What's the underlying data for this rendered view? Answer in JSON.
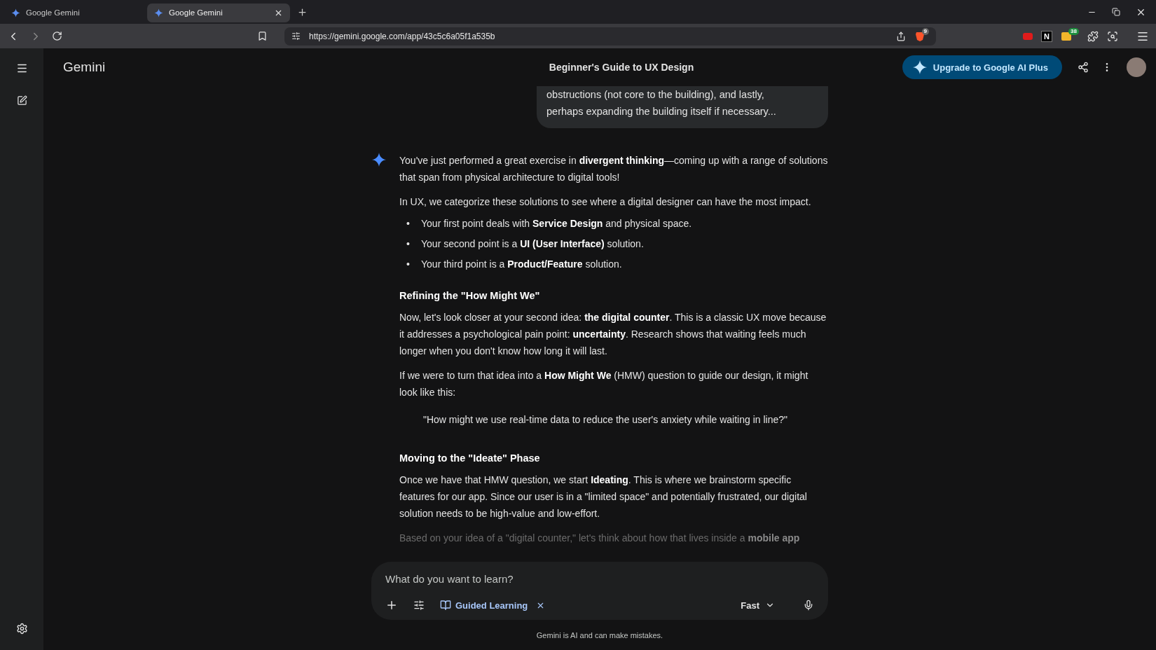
{
  "browser": {
    "tabs": [
      {
        "title": "Google Gemini",
        "selected": false
      },
      {
        "title": "Google Gemini",
        "selected": true
      }
    ],
    "url": "https://gemini.google.com/app/43c5c6a05f1a535b",
    "shield_badge": "9",
    "extensions": [
      {
        "kind": "red"
      },
      {
        "kind": "letter",
        "label": "N"
      },
      {
        "kind": "folder",
        "badge": "38"
      },
      {
        "kind": "puzzle"
      },
      {
        "kind": "reader"
      }
    ]
  },
  "app": {
    "brand": "Gemini",
    "chat_title": "Beginner's Guide to UX Design",
    "upgrade_button": "Upgrade to Google AI Plus"
  },
  "user_message": [
    "obstructions (not core to the building), and lastly,",
    "perhaps expanding the building itself if necessary..."
  ],
  "response": [
    {
      "kind": "paragraph",
      "text": "You've just performed a great exercise in **divergent thinking**—coming up with a range of solutions that span from physical architecture to digital tools!"
    },
    {
      "kind": "paragraph",
      "text": "In UX, we categorize these solutions to see where a digital designer can have the most impact."
    },
    {
      "kind": "bullets",
      "items": [
        {
          "marker": "•",
          "text": "Your first point deals with **Service Design** and physical space."
        },
        {
          "marker": "•",
          "text": "Your second point is a **UI (User Interface)** solution."
        },
        {
          "marker": "•",
          "text": "Your third point is a **Product/Feature** solution."
        }
      ]
    },
    {
      "kind": "heading",
      "text": "Refining the \"How Might We\""
    },
    {
      "kind": "paragraph",
      "text": "Now, let's look closer at your second idea: **the digital counter**. This is a classic UX move because it addresses a psychological pain point: **uncertainty**. Research shows that waiting feels much longer when you don't know how long it will last."
    },
    {
      "kind": "paragraph",
      "text": "If we were to turn that idea into a **How Might We** (HMW) question to guide our design, it might look like this:"
    },
    {
      "kind": "quote",
      "text": "\"How might we use real-time data to reduce the user's anxiety while waiting in line?\""
    },
    {
      "kind": "heading",
      "text": "Moving to the \"Ideate\" Phase"
    },
    {
      "kind": "paragraph",
      "text": "Once we have that HMW question, we start **Ideating**. This is where we brainstorm specific features for our app. Since our user is in a \"limited space\" and potentially frustrated, our digital solution needs to be high-value and low-effort."
    },
    {
      "kind": "faded",
      "text": "Based on your idea of a \"digital counter,\" let's think about how that lives inside a **mobile app**"
    }
  ],
  "composer": {
    "placeholder": "What do you want to learn?",
    "tool_chip": "Guided Learning",
    "model": "Fast"
  },
  "disclaimer": "Gemini is AI and can make mistakes."
}
